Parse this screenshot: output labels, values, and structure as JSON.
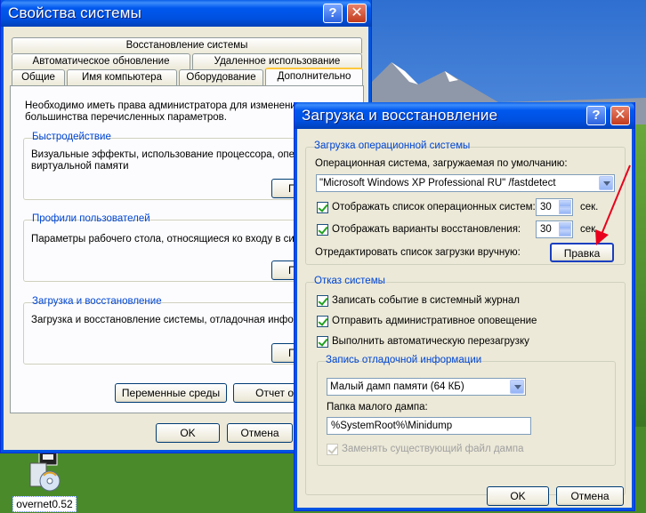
{
  "desktop": {
    "icon_label": "overnet0.52"
  },
  "sysprops": {
    "title": "Свойства системы",
    "tabs_row1": [
      "Восстановление системы"
    ],
    "tabs_row2": [
      "Автоматическое обновление",
      "Удаленное использование"
    ],
    "tabs_row3": [
      "Общие",
      "Имя компьютера",
      "Оборудование",
      "Дополнительно"
    ],
    "active_tab": "Дополнительно",
    "intro": "Необходимо иметь права администратора для изменения большинства перечисленных параметров.",
    "intro_line1": "Необходимо иметь права администратора для изменения",
    "intro_line2": "большинства перечисленных параметров.",
    "perf": {
      "title": "Быстродействие",
      "line1": "Визуальные эффекты, использование процессора, опера",
      "line2": "виртуальной памяти",
      "button": "Пар"
    },
    "profiles": {
      "title": "Профили пользователей",
      "line1": "Параметры рабочего стола, относящиеся ко входу в систе",
      "button": "Пар"
    },
    "startup": {
      "title": "Загрузка и восстановление",
      "line1": "Загрузка и восстановление системы, отладочная информ",
      "button": "Пар"
    },
    "env_button": "Переменные среды",
    "errrep_button": "Отчет об о",
    "ok": "OK",
    "cancel": "Отмена"
  },
  "startup_dialog": {
    "title": "Загрузка и восстановление",
    "os_group": {
      "title": "Загрузка операционной системы",
      "default_os_label": "Операционная система, загружаемая по умолчанию:",
      "default_os_value": "\"Microsoft Windows XP Professional RU\" /fastdetect",
      "show_os_list_label": "Отображать список операционных систем:",
      "show_os_list_checked": true,
      "show_os_list_value": "30",
      "show_recovery_label": "Отображать варианты восстановления:",
      "show_recovery_checked": true,
      "show_recovery_value": "30",
      "sec_unit": "сек.",
      "edit_label": "Отредактировать список загрузки вручную:",
      "edit_button": "Правка"
    },
    "failure_group": {
      "title": "Отказ системы",
      "write_event_label": "Записать событие в системный журнал",
      "write_event_checked": true,
      "send_alert_label": "Отправить административное оповещение",
      "send_alert_checked": true,
      "auto_restart_label": "Выполнить автоматическую перезагрузку",
      "auto_restart_checked": true
    },
    "debug_group": {
      "title": "Запись отладочной информации",
      "dump_type_value": "Малый дамп памяти (64 КБ)",
      "dump_dir_label": "Папка малого дампа:",
      "dump_dir_value": "%SystemRoot%\\Minidump",
      "overwrite_label": "Заменять существующий файл дампа",
      "overwrite_checked": true,
      "overwrite_enabled": false
    },
    "ok": "OK",
    "cancel": "Отмена"
  },
  "colors": {
    "title_blue": "#0054e3",
    "dialog_bg": "#ece9d8",
    "group_title": "#0046d5",
    "arrow_red": "#e8001c"
  }
}
